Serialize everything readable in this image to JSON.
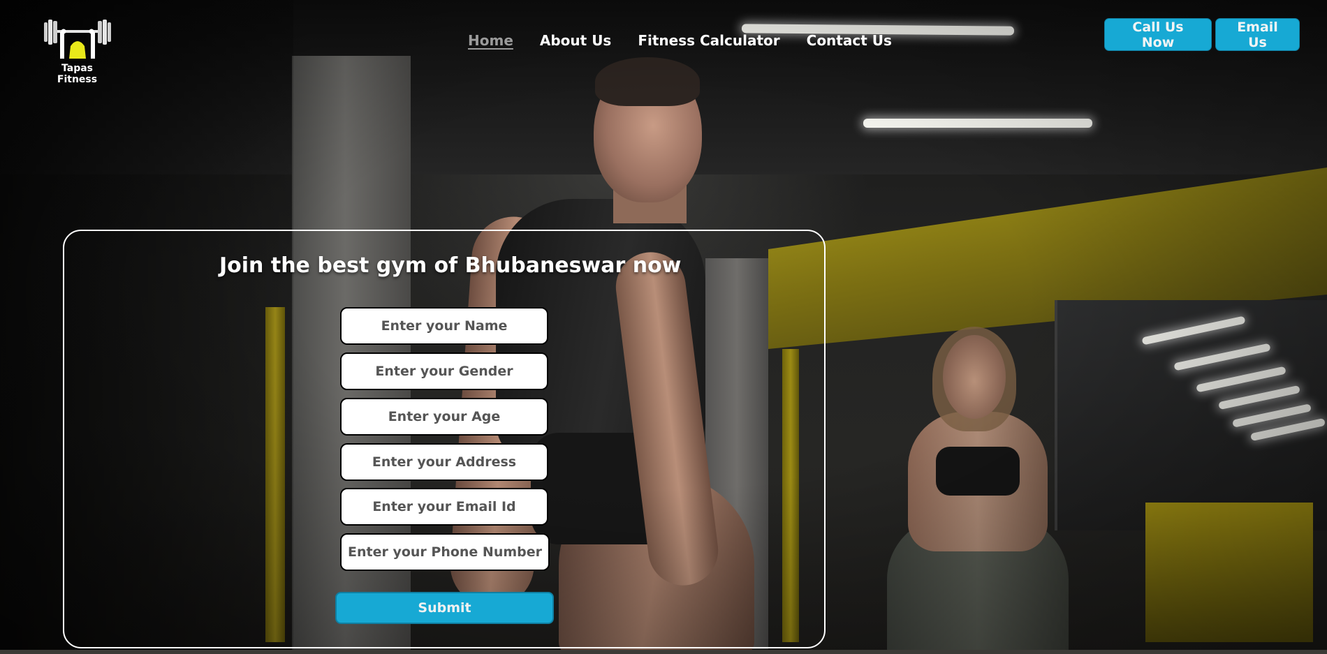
{
  "brand": {
    "name": "Tapas Fitness",
    "logo_icon": "barbell-icon",
    "accent": "#17a9d4",
    "logo_yellow": "#e8e81a"
  },
  "nav": {
    "items": [
      {
        "label": "Home",
        "active": true
      },
      {
        "label": "About Us",
        "active": false
      },
      {
        "label": "Fitness Calculator",
        "active": false
      },
      {
        "label": "Contact Us",
        "active": false
      }
    ]
  },
  "header_buttons": {
    "call": "Call Us Now",
    "email": "Email Us"
  },
  "form": {
    "title": "Join the best gym of Bhubaneswar now",
    "fields": [
      {
        "placeholder": "Enter your Name"
      },
      {
        "placeholder": "Enter your Gender"
      },
      {
        "placeholder": "Enter your Age"
      },
      {
        "placeholder": "Enter your Address"
      },
      {
        "placeholder": "Enter your Email Id"
      },
      {
        "placeholder": "Enter your Phone Number"
      }
    ],
    "submit": "Submit"
  }
}
